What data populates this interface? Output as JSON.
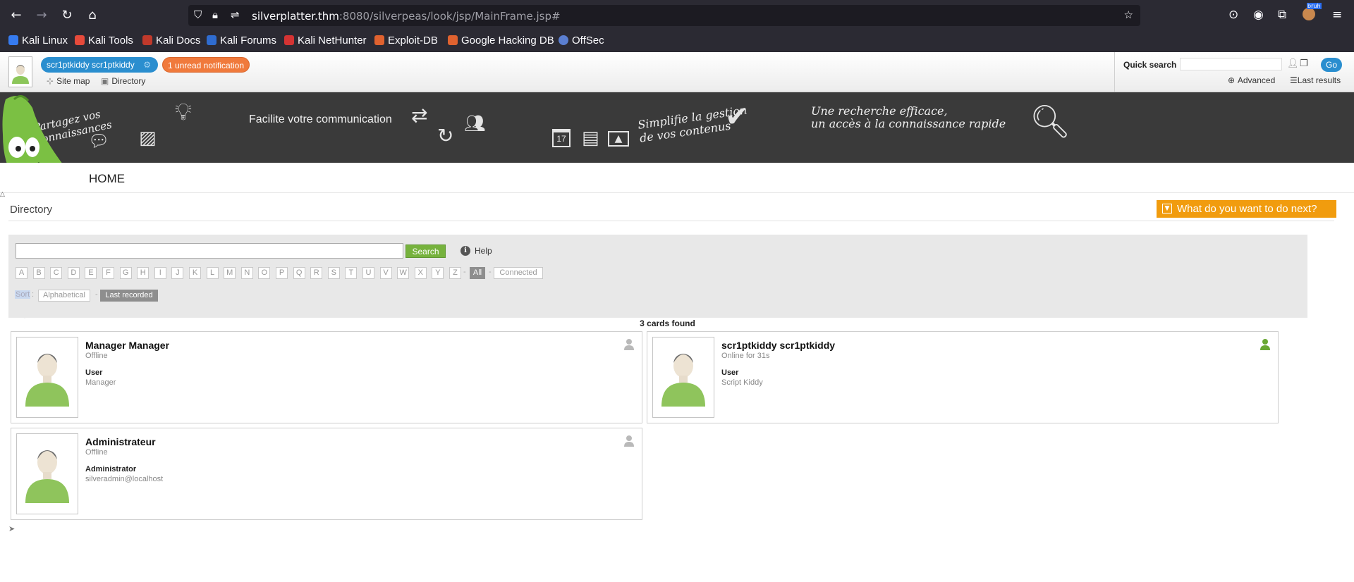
{
  "browser": {
    "url_host": "silverplatter.thm",
    "url_path": ":8080/silverpeas/look/jsp/MainFrame.jsp#",
    "extension_badge": "bruh",
    "bookmarks": [
      {
        "label": "Kali Linux",
        "color": "#367bf0"
      },
      {
        "label": "Kali Tools",
        "color": "#e64a3b"
      },
      {
        "label": "Kali Docs",
        "color": "#c0392b"
      },
      {
        "label": "Kali Forums",
        "color": "#2f6cd0"
      },
      {
        "label": "Kali NetHunter",
        "color": "#d43333"
      },
      {
        "label": "Exploit-DB",
        "color": "#e0622f"
      },
      {
        "label": "Google Hacking DB",
        "color": "#e0622f"
      },
      {
        "label": "OffSec",
        "color": "#5b7fd1"
      }
    ]
  },
  "topbar": {
    "user_name": "scr1ptkiddy scr1ptkiddy",
    "notifications": "1 unread notification",
    "site_map": "Site map",
    "directory": "Directory",
    "quick_search_label": "Quick search",
    "go": "Go",
    "advanced": "Advanced",
    "last_results": "Last results"
  },
  "banner": {
    "t1": "Partagez vos connaissances",
    "t2": "Facilite votre communication",
    "t3a": "Simplifie la gestion",
    "t3b": "de vos contenus",
    "t4a": "Une recherche efficace,",
    "t4b": "un accès à la connaissance rapide",
    "calendar_day": "17",
    "home": "HOME"
  },
  "page": {
    "title": "Directory",
    "next": "What do you want to do next?",
    "search_button": "Search",
    "help": "Help",
    "letters": [
      "A",
      "B",
      "C",
      "D",
      "E",
      "F",
      "G",
      "H",
      "I",
      "J",
      "K",
      "L",
      "M",
      "N",
      "O",
      "P",
      "Q",
      "R",
      "S",
      "T",
      "U",
      "V",
      "W",
      "X",
      "Y",
      "Z"
    ],
    "all": "All",
    "connected": "Connected",
    "sort": "Sort",
    "alphabetical": "Alphabetical",
    "last_recorded": "Last recorded",
    "cards_found": "3 cards found"
  },
  "cards": [
    {
      "name": "Manager Manager",
      "status": "Offline",
      "role": "User",
      "info": "Manager",
      "online": false
    },
    {
      "name": "scr1ptkiddy scr1ptkiddy",
      "status": "Online for 31s",
      "role": "User",
      "info": "Script Kiddy",
      "online": true
    },
    {
      "name": "Administrateur",
      "status": "Offline",
      "role": "Administrator",
      "info": "silveradmin@localhost",
      "online": false
    }
  ]
}
